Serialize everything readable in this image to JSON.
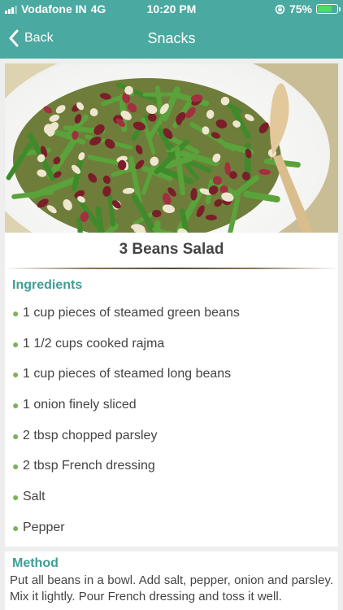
{
  "status": {
    "carrier": "Vodafone IN",
    "network": "4G",
    "time": "10:20 PM",
    "battery_percent": "75%",
    "battery_level": 0.75,
    "signal_bars": 3,
    "battery_color": "#4cd964"
  },
  "nav": {
    "back_label": "Back",
    "title": "Snacks",
    "color": "#4aa9a0"
  },
  "recipe": {
    "title": "3 Beans Salad",
    "ingredients_heading": "Ingredients",
    "ingredients": [
      "1 cup pieces of steamed green beans",
      "1 1/2 cups cooked rajma",
      "1 cup pieces of steamed long beans",
      "1 onion finely sliced",
      "2 tbsp chopped parsley",
      "2 tbsp French dressing",
      "Salt",
      "Pepper"
    ],
    "method_heading": "Method",
    "method_text": "Put all beans in a bowl. Add salt, pepper, onion and parsley. Mix it lightly. Pour French dressing and toss it well."
  }
}
